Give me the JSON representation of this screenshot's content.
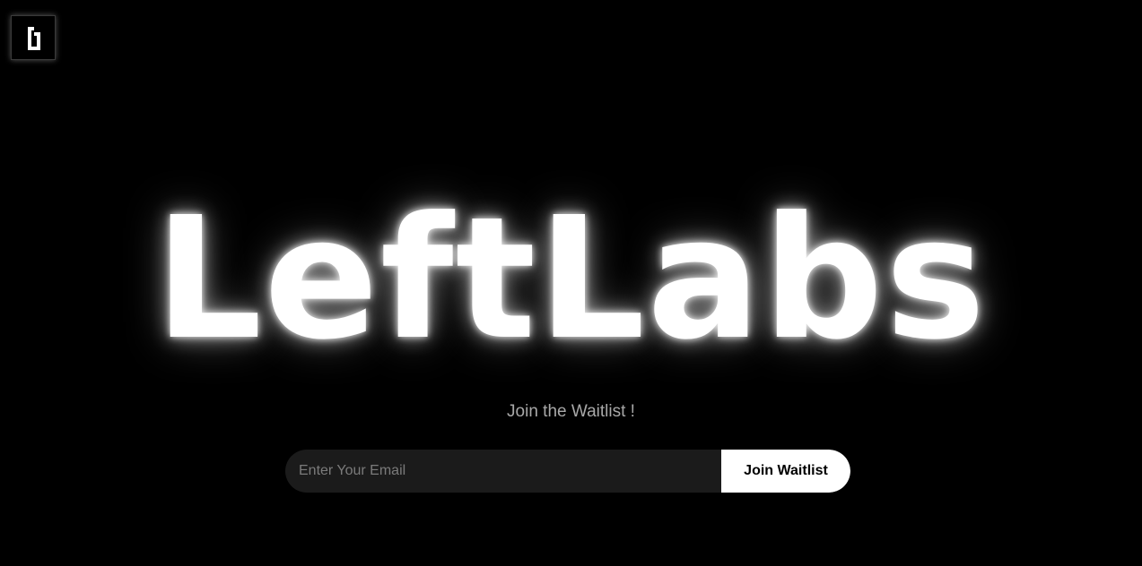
{
  "logo": {
    "icon": "leftlabs-logo-icon"
  },
  "hero": {
    "title": "LeftLabs"
  },
  "waitlist": {
    "subtitle": "Join the Waitlist !",
    "email_placeholder": "Enter Your Email",
    "email_value": "",
    "button_label": "Join Waitlist"
  },
  "colors": {
    "background": "#000000",
    "title": "#ffffff",
    "subtitle": "#a8a8a8",
    "input_background": "#1b1b1b",
    "button_background": "#ffffff",
    "button_text": "#000000"
  }
}
